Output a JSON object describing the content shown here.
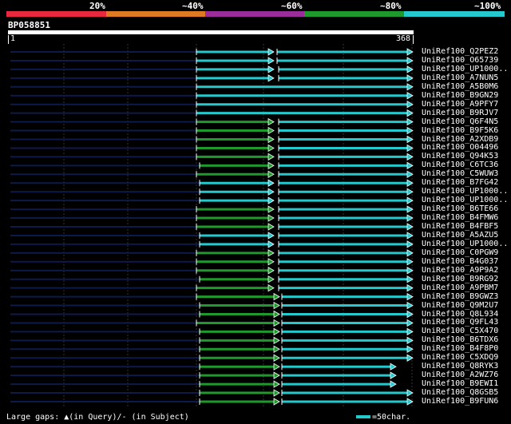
{
  "legend": {
    "labels": [
      "20%",
      "~40%",
      "~60%",
      "~80%",
      "~100%"
    ],
    "colors": [
      "#e8283c",
      "#e07a22",
      "#9a2d9a",
      "#1e9a2d",
      "#23c9cd"
    ]
  },
  "query": {
    "name": "BP058851",
    "start": "1",
    "end": "368"
  },
  "footer": {
    "gaps_text": "Large gaps: ▲(in Query)/- (in Subject)",
    "scale_text": "=50char."
  },
  "hits": [
    {
      "label": "UniRef100_Q2PEZ2",
      "segs": [
        [
          "navy",
          13,
          246
        ],
        [
          "cyan",
          246,
          343
        ]
      ],
      "gap": [
        "cyan",
        347,
        517
      ]
    },
    {
      "label": "UniRef100_O65739",
      "segs": [
        [
          "navy",
          13,
          246
        ],
        [
          "cyan",
          246,
          343
        ]
      ],
      "gap": [
        "cyan",
        347,
        517
      ]
    },
    {
      "label": "UniRef100_UP1000..",
      "segs": [
        [
          "navy",
          13,
          246
        ],
        [
          "cyan",
          246,
          343
        ],
        [
          "cyan",
          349,
          517
        ]
      ]
    },
    {
      "label": "UniRef100_A7NUN5",
      "segs": [
        [
          "navy",
          13,
          246
        ],
        [
          "cyan",
          246,
          343
        ],
        [
          "cyan",
          349,
          517
        ]
      ]
    },
    {
      "label": "UniRef100_A5B0M6",
      "segs": [
        [
          "navy",
          13,
          246
        ],
        [
          "cyan",
          246,
          517
        ]
      ]
    },
    {
      "label": "UniRef100_B9GN29",
      "segs": [
        [
          "navy",
          13,
          246
        ],
        [
          "cyan",
          246,
          517
        ]
      ]
    },
    {
      "label": "UniRef100_A9PFY7",
      "segs": [
        [
          "navy",
          13,
          246
        ],
        [
          "cyan",
          246,
          517
        ]
      ]
    },
    {
      "label": "UniRef100_B9RJV7",
      "segs": [
        [
          "navy",
          13,
          246
        ],
        [
          "cyan",
          246,
          517
        ]
      ]
    },
    {
      "label": "UniRef100_Q6F4N5",
      "segs": [
        [
          "navy",
          13,
          246
        ],
        [
          "green",
          246,
          343
        ],
        [
          "cyan",
          349,
          517
        ]
      ]
    },
    {
      "label": "UniRef100_B9F5K6",
      "segs": [
        [
          "navy",
          13,
          246
        ],
        [
          "green",
          246,
          343
        ],
        [
          "cyan",
          349,
          517
        ]
      ]
    },
    {
      "label": "UniRef100_A2XDB9",
      "segs": [
        [
          "navy",
          13,
          246
        ],
        [
          "green",
          246,
          343
        ],
        [
          "cyan",
          349,
          517
        ]
      ]
    },
    {
      "label": "UniRef100_O04496",
      "segs": [
        [
          "navy",
          13,
          246
        ],
        [
          "green",
          246,
          343
        ],
        [
          "cyan",
          349,
          517
        ]
      ]
    },
    {
      "label": "UniRef100_Q94K53",
      "segs": [
        [
          "navy",
          13,
          246
        ],
        [
          "green",
          246,
          343
        ],
        [
          "cyan",
          349,
          517
        ]
      ]
    },
    {
      "label": "UniRef100_C6TC36",
      "segs": [
        [
          "navy",
          13,
          250
        ],
        [
          "green",
          250,
          343
        ],
        [
          "cyan",
          349,
          517
        ]
      ]
    },
    {
      "label": "UniRef100_C5WUW3",
      "segs": [
        [
          "navy",
          13,
          246
        ],
        [
          "green",
          246,
          343
        ],
        [
          "cyan",
          349,
          517
        ]
      ]
    },
    {
      "label": "UniRef100_B7FG42",
      "segs": [
        [
          "navy",
          13,
          250
        ],
        [
          "cyan",
          250,
          343
        ],
        [
          "cyan",
          349,
          517
        ]
      ]
    },
    {
      "label": "UniRef100_UP1000..",
      "segs": [
        [
          "navy",
          13,
          250
        ],
        [
          "cyan",
          250,
          343
        ],
        [
          "cyan",
          349,
          517
        ]
      ]
    },
    {
      "label": "UniRef100_UP1000..",
      "segs": [
        [
          "navy",
          13,
          250
        ],
        [
          "cyan",
          250,
          343
        ],
        [
          "cyan",
          349,
          517
        ]
      ]
    },
    {
      "label": "UniRef100_B6TE66",
      "segs": [
        [
          "navy",
          13,
          246
        ],
        [
          "green",
          246,
          343
        ],
        [
          "cyan",
          349,
          517
        ]
      ]
    },
    {
      "label": "UniRef100_B4FMW6",
      "segs": [
        [
          "navy",
          13,
          246
        ],
        [
          "green",
          246,
          343
        ],
        [
          "cyan",
          349,
          517
        ]
      ]
    },
    {
      "label": "UniRef100_B4FBF5",
      "segs": [
        [
          "navy",
          13,
          246
        ],
        [
          "green",
          246,
          343
        ],
        [
          "cyan",
          349,
          517
        ]
      ]
    },
    {
      "label": "UniRef100_A5AZU5",
      "segs": [
        [
          "navy",
          13,
          250
        ],
        [
          "cyan",
          250,
          343
        ],
        [
          "cyan",
          349,
          517
        ]
      ]
    },
    {
      "label": "UniRef100_UP1000..",
      "segs": [
        [
          "navy",
          13,
          250
        ],
        [
          "cyan",
          250,
          343
        ],
        [
          "cyan",
          349,
          517
        ]
      ]
    },
    {
      "label": "UniRef100_C0PGW9",
      "segs": [
        [
          "navy",
          13,
          246
        ],
        [
          "green",
          246,
          343
        ],
        [
          "cyan",
          349,
          517
        ]
      ]
    },
    {
      "label": "UniRef100_B4G037",
      "segs": [
        [
          "navy",
          13,
          246
        ],
        [
          "green",
          246,
          343
        ],
        [
          "cyan",
          349,
          517
        ]
      ]
    },
    {
      "label": "UniRef100_A9P9A2",
      "segs": [
        [
          "navy",
          13,
          246
        ],
        [
          "green",
          246,
          343
        ],
        [
          "cyan",
          349,
          517
        ]
      ]
    },
    {
      "label": "UniRef100_B9RG92",
      "segs": [
        [
          "navy",
          13,
          250
        ],
        [
          "green",
          250,
          343
        ],
        [
          "cyan",
          349,
          517
        ]
      ]
    },
    {
      "label": "UniRef100_A9PBM7",
      "segs": [
        [
          "navy",
          13,
          246
        ],
        [
          "green",
          246,
          343
        ],
        [
          "cyan",
          349,
          517
        ]
      ]
    },
    {
      "label": "UniRef100_B9GWZ3",
      "segs": [
        [
          "navy",
          13,
          246
        ],
        [
          "green",
          246,
          350
        ],
        [
          "cyan",
          353,
          517
        ]
      ]
    },
    {
      "label": "UniRef100_Q9M2U7",
      "segs": [
        [
          "navy",
          13,
          250
        ],
        [
          "green",
          250,
          350
        ],
        [
          "cyan",
          353,
          517
        ]
      ]
    },
    {
      "label": "UniRef100_Q8L934",
      "segs": [
        [
          "navy",
          13,
          250
        ],
        [
          "green",
          250,
          350
        ],
        [
          "cyan",
          353,
          517
        ]
      ]
    },
    {
      "label": "UniRef100_Q9FL43",
      "segs": [
        [
          "navy",
          13,
          246
        ],
        [
          "green",
          246,
          350
        ],
        [
          "cyan",
          353,
          517
        ]
      ]
    },
    {
      "label": "UniRef100_C5X470",
      "segs": [
        [
          "navy",
          13,
          250
        ],
        [
          "green",
          250,
          350
        ],
        [
          "cyan",
          353,
          517
        ]
      ]
    },
    {
      "label": "UniRef100_B6TDX6",
      "segs": [
        [
          "navy",
          13,
          250
        ],
        [
          "green",
          250,
          350
        ],
        [
          "cyan",
          353,
          517
        ]
      ]
    },
    {
      "label": "UniRef100_B4F8P0",
      "segs": [
        [
          "navy",
          13,
          250
        ],
        [
          "green",
          250,
          350
        ],
        [
          "cyan",
          353,
          517
        ]
      ]
    },
    {
      "label": "UniRef100_C5XDQ9",
      "segs": [
        [
          "navy",
          13,
          250
        ],
        [
          "green",
          250,
          350
        ],
        [
          "cyan",
          353,
          517
        ]
      ]
    },
    {
      "label": "UniRef100_Q8RYK3",
      "segs": [
        [
          "navy",
          13,
          250
        ],
        [
          "green",
          250,
          350
        ],
        [
          "cyan",
          353,
          496
        ]
      ]
    },
    {
      "label": "UniRef100_A2WZ76",
      "segs": [
        [
          "navy",
          13,
          250
        ],
        [
          "green",
          250,
          350
        ],
        [
          "cyan",
          353,
          496
        ]
      ]
    },
    {
      "label": "UniRef100_B9EWI1",
      "segs": [
        [
          "navy",
          13,
          250
        ],
        [
          "green",
          250,
          350
        ],
        [
          "cyan",
          353,
          496
        ]
      ]
    },
    {
      "label": "UniRef100_Q8GSB5",
      "segs": [
        [
          "navy",
          13,
          250
        ],
        [
          "green",
          250,
          350
        ],
        [
          "cyan",
          353,
          517
        ]
      ]
    },
    {
      "label": "UniRef100_B9FUN6",
      "segs": [
        [
          "navy",
          13,
          250
        ],
        [
          "green",
          250,
          350
        ],
        [
          "cyan",
          353,
          517
        ]
      ]
    }
  ]
}
